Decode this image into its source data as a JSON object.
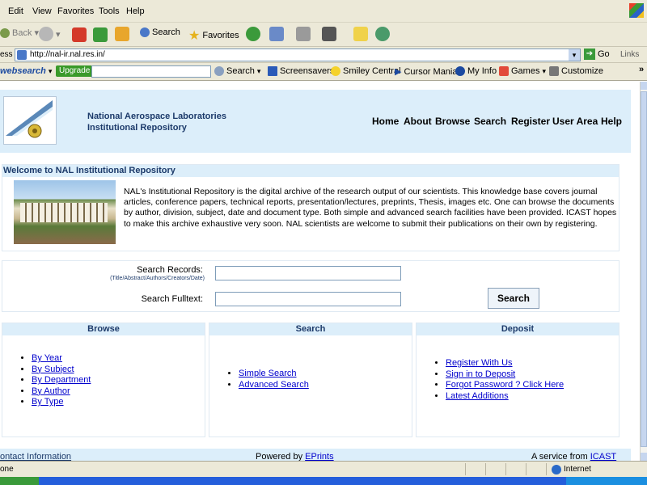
{
  "browser": {
    "menu": [
      "Edit",
      "View",
      "Favorites",
      "Tools",
      "Help"
    ],
    "toolbar": {
      "back": "Back",
      "search": "Search",
      "favorites": "Favorites"
    },
    "address": {
      "label": "ess",
      "url": "http://nal-ir.nal.res.in/",
      "go": "Go",
      "links": "Links"
    },
    "websearch": {
      "brand": "websearch",
      "upgrade": "Upgrade",
      "search": "Search",
      "items": [
        "Screensavers",
        "Smiley Central",
        "Cursor Mania",
        "My Info",
        "Games",
        "Customize"
      ]
    },
    "status": {
      "text": "one",
      "zone": "Internet"
    }
  },
  "header": {
    "title_line1": "National Aerospace Laboratories",
    "title_line2": "Institutional Repository",
    "nav": [
      "Home",
      "About",
      "Browse",
      "Search",
      "Register",
      "User Area",
      "Help"
    ]
  },
  "welcome": {
    "heading": "Welcome to NAL Institutional Repository",
    "text": "NAL's Institutional Repository is the digital archive of the research output of our scientists. This knowledge base covers journal articles, conference papers, technical reports, presentation/lectures, preprints, Thesis, images etc. One can browse the documents by author, division, subject, date and document type. Both simple and advanced search facilities have been provided. ICAST hopes to make this archive exhaustive very soon. NAL scientists are welcome to submit their publications on their own by registering."
  },
  "search_form": {
    "records_label": "Search Records:",
    "records_hint": "(Title/Abstract/Authors/Creators/Date)",
    "records_value": "",
    "fulltext_label": "Search Fulltext:",
    "fulltext_value": "",
    "button": "Search"
  },
  "columns": {
    "browse": {
      "title": "Browse",
      "links": [
        "By Year",
        "By Subject",
        "By Department",
        "By Author",
        "By Type"
      ]
    },
    "search": {
      "title": "Search",
      "links": [
        "Simple Search",
        "Advanced Search"
      ]
    },
    "deposit": {
      "title": "Deposit",
      "links": [
        "Register With Us",
        "Sign in to Deposit",
        "Forgot Password ? Click Here",
        "Latest Additions"
      ]
    }
  },
  "footer": {
    "contact": "ontact Information",
    "powered_prefix": "Powered by ",
    "powered_link": "EPrints",
    "service_prefix": "A service from ",
    "service_link": "ICAST"
  },
  "colors": {
    "header_bg": "#dceefa",
    "link": "#0000cc",
    "heading": "#1c3a6a"
  }
}
